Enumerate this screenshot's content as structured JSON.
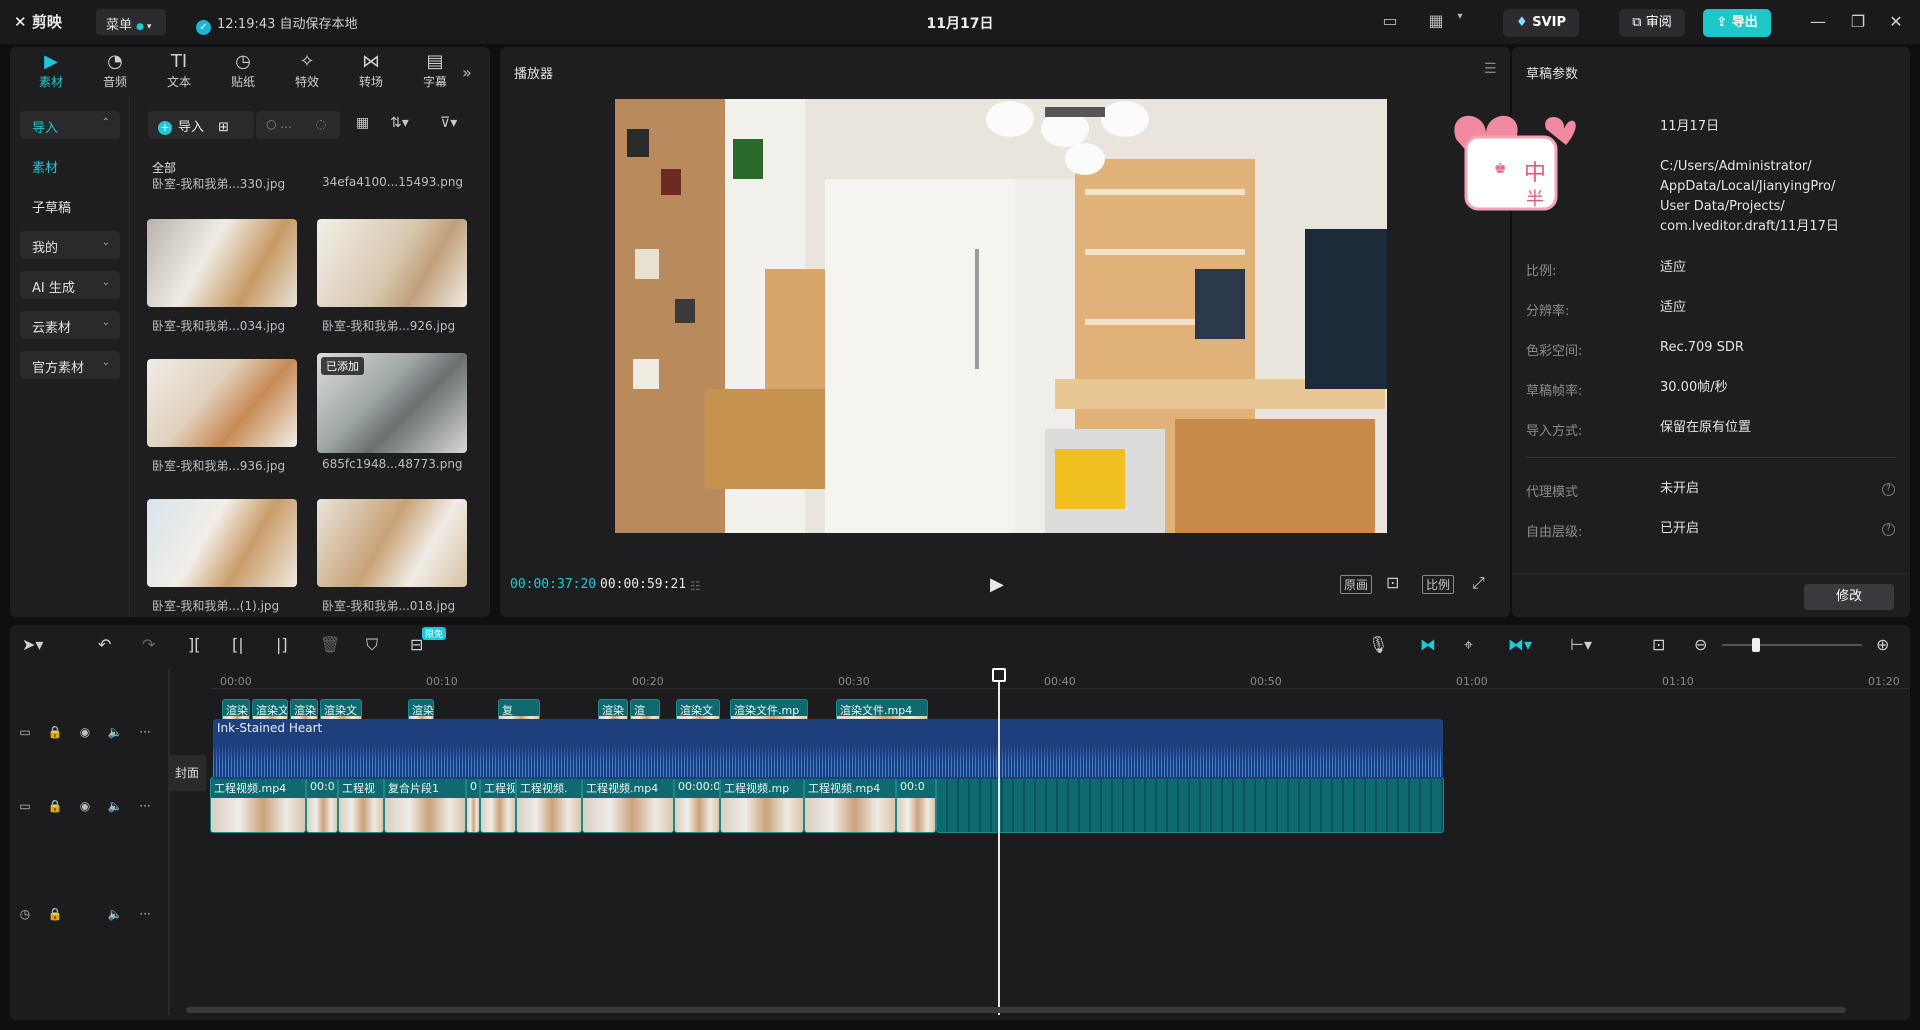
{
  "app": {
    "logo": "剪映",
    "menu_label": "菜单",
    "save_time": "12:19:43",
    "save_text": "自动保存本地",
    "title": "11月17日",
    "svip_label": "SVIP",
    "review_label": "审阅",
    "export_label": "导出"
  },
  "media": {
    "tabs": [
      {
        "label": "素材",
        "icon": "media-icon"
      },
      {
        "label": "音频",
        "icon": "audio-icon"
      },
      {
        "label": "文本",
        "icon": "text-icon"
      },
      {
        "label": "贴纸",
        "icon": "sticker-icon"
      },
      {
        "label": "特效",
        "icon": "effects-icon"
      },
      {
        "label": "转场",
        "icon": "transition-icon"
      },
      {
        "label": "字幕",
        "icon": "caption-icon"
      }
    ],
    "sidebar": [
      {
        "label": "导入"
      },
      {
        "label": "素材"
      },
      {
        "label": "子草稿"
      },
      {
        "label": "我的"
      },
      {
        "label": "AI 生成"
      },
      {
        "label": "云素材"
      },
      {
        "label": "官方素材"
      }
    ],
    "import_label": "导入",
    "search_placeholder": "...",
    "all_label": "全部",
    "added_badge": "已添加",
    "items": [
      {
        "caption": "卧室-我和我弟...330.jpg"
      },
      {
        "caption": "34efa4100...15493.png"
      },
      {
        "caption": "卧室-我和我弟...034.jpg"
      },
      {
        "caption": "卧室-我和我弟...926.jpg"
      },
      {
        "caption": "卧室-我和我弟...936.jpg"
      },
      {
        "caption": "685fc1948...48773.png"
      },
      {
        "caption": "卧室-我和我弟...(1).jpg"
      },
      {
        "caption": "卧室-我和我弟...018.jpg"
      }
    ]
  },
  "player": {
    "title": "播放器",
    "current_time": "00:00:37:20",
    "total_time": "00:00:59:21",
    "btn_original": "原画",
    "btn_ratio": "比例"
  },
  "props": {
    "title": "草稿参数",
    "name_value": "11月17日",
    "path_lines": [
      "C:/Users/Administrator/",
      "AppData/Local/JianyingPro/",
      "User Data/Projects/",
      "com.lveditor.draft/11月17日"
    ],
    "rows": [
      {
        "label": "比例:",
        "value": "适应"
      },
      {
        "label": "分辨率:",
        "value": "适应"
      },
      {
        "label": "色彩空间:",
        "value": "Rec.709 SDR"
      },
      {
        "label": "草稿帧率:",
        "value": "30.00帧/秒"
      },
      {
        "label": "导入方式:",
        "value": "保留在原有位置"
      }
    ],
    "rows2": [
      {
        "label": "代理模式",
        "value": "未开启"
      },
      {
        "label": "自由层级:",
        "value": "已开启"
      }
    ],
    "modify_label": "修改",
    "sticker_chars": [
      "中",
      "半"
    ]
  },
  "timeline": {
    "free_badge": "限免",
    "ticks": [
      "00:00",
      "00:10",
      "00:20",
      "00:30",
      "00:40",
      "00:50",
      "01:00",
      "01:10",
      "01:20"
    ],
    "overlay_clips": [
      "渲染",
      "渲染文",
      "渲染",
      "渲染文",
      "渲染",
      "复",
      "渲染",
      "渲",
      "渲染文",
      "渲染文件.mp",
      "渲染文件.mp4"
    ],
    "main_clips": [
      "工程视频.mp4",
      "00:0",
      "工程视",
      "复合片段1",
      "0",
      "工程视",
      "工程视频.",
      "工程视频.mp4",
      "00:00:0",
      "工程视频.mp",
      "工程视频.mp4",
      "00:0"
    ],
    "cover_label": "封面",
    "audio_label": "Ink-Stained Heart"
  }
}
